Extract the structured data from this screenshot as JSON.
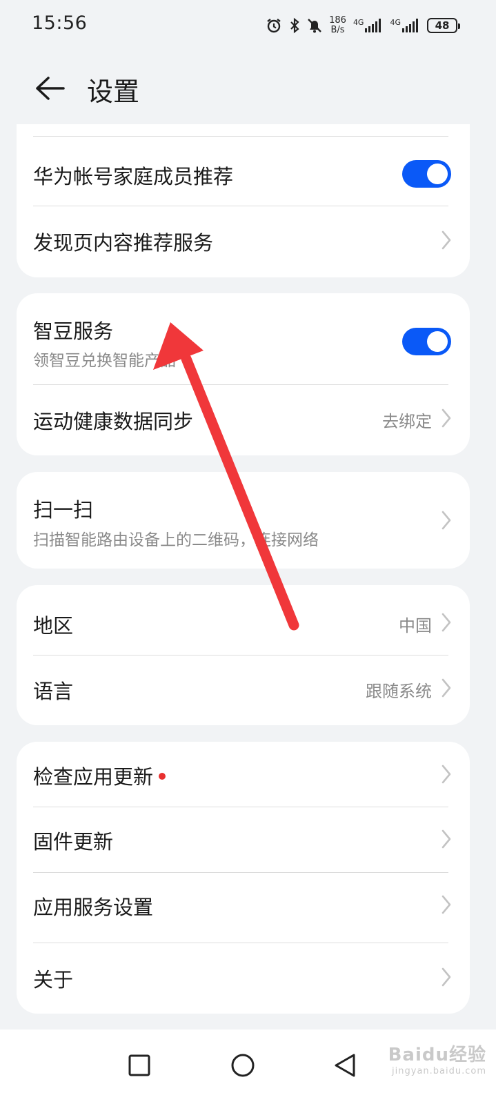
{
  "status_bar": {
    "time": "15:56",
    "net_speed_value": "186",
    "net_speed_unit": "B/s",
    "signal1_label": "4G",
    "signal2_label": "4G",
    "battery_level": "48",
    "icons": [
      "alarm-icon",
      "bluetooth-icon",
      "mute-bell-icon",
      "signal-icon",
      "signal-icon",
      "battery-icon"
    ]
  },
  "header": {
    "title": "设置",
    "back_icon": "back-arrow-icon"
  },
  "card1": {
    "items": [
      {
        "label": "华为帐号家庭成员推荐",
        "toggle_on": true
      },
      {
        "label": "发现页内容推荐服务"
      }
    ]
  },
  "card2": {
    "items": [
      {
        "label": "智豆服务",
        "sublabel": "领智豆兑换智能产品",
        "toggle_on": true
      },
      {
        "label": "运动健康数据同步",
        "value": "去绑定"
      }
    ]
  },
  "card3": {
    "items": [
      {
        "label": "扫一扫",
        "sublabel": "扫描智能路由设备上的二维码，连接网络"
      }
    ]
  },
  "card4": {
    "items": [
      {
        "label": "地区",
        "value": "中国"
      },
      {
        "label": "语言",
        "value": "跟随系统"
      }
    ]
  },
  "card5": {
    "items": [
      {
        "label": "检查应用更新",
        "badge": "red-dot"
      },
      {
        "label": "固件更新"
      },
      {
        "label": "应用服务设置"
      },
      {
        "label": "关于"
      }
    ]
  },
  "colors": {
    "toggle_on": "#0a59f7",
    "badge": "#e8302f",
    "annotation_arrow": "#f0373a",
    "background": "#f1f3f5"
  },
  "nav_bar": {
    "buttons": [
      "recent-apps-icon",
      "home-icon",
      "back-triangle-icon"
    ]
  },
  "watermark": {
    "main": "Baidu经验",
    "sub": "jingyan.baidu.com"
  }
}
